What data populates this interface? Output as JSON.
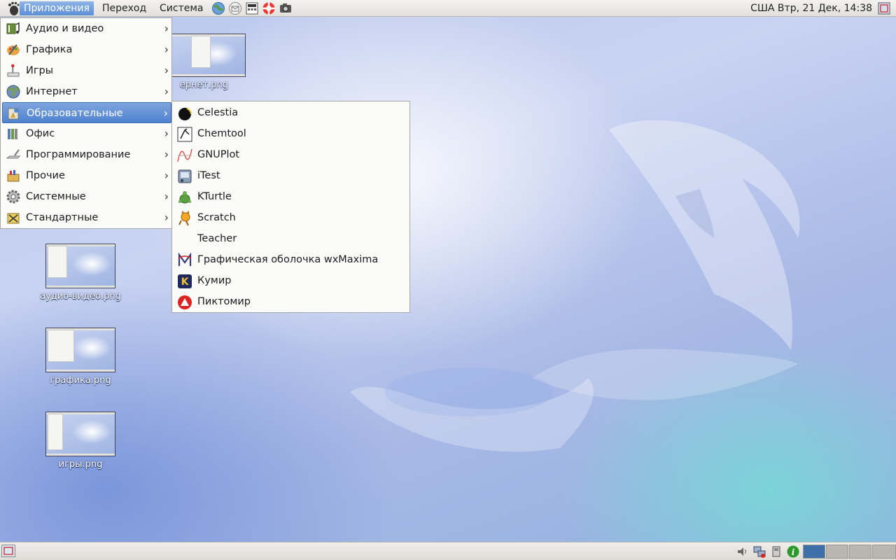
{
  "top_panel": {
    "menus": {
      "applications": "Приложения",
      "places": "Переход",
      "system": "Система"
    },
    "launchers": [
      "web-browser-icon",
      "mail-icon",
      "calculator-icon",
      "help-icon",
      "screenshot-icon"
    ],
    "clock": "США Втр, 21 Дек, 14:38"
  },
  "desktop_icons": [
    {
      "label": "Интернет.png",
      "visible_label": "ернет.png"
    },
    {
      "label": "аудио-видео.png"
    },
    {
      "label": "графика.png"
    },
    {
      "label": "игры.png"
    }
  ],
  "main_menu": {
    "items": [
      {
        "label": "Аудио и видео",
        "icon": "audio-video-icon"
      },
      {
        "label": "Графика",
        "icon": "graphics-icon"
      },
      {
        "label": "Игры",
        "icon": "games-icon"
      },
      {
        "label": "Интернет",
        "icon": "internet-icon"
      },
      {
        "label": "Образовательные",
        "icon": "education-icon",
        "active": true
      },
      {
        "label": "Офис",
        "icon": "office-icon"
      },
      {
        "label": "Программирование",
        "icon": "programming-icon"
      },
      {
        "label": "Прочие",
        "icon": "other-icon"
      },
      {
        "label": "Системные",
        "icon": "system-icon"
      },
      {
        "label": "Стандартные",
        "icon": "accessories-icon"
      }
    ],
    "arrow": "›"
  },
  "sub_menu": {
    "items": [
      {
        "label": "Celestia",
        "icon": "celestia-icon"
      },
      {
        "label": "Chemtool",
        "icon": "chemtool-icon"
      },
      {
        "label": "GNUPlot",
        "icon": "gnuplot-icon"
      },
      {
        "label": "iTest",
        "icon": "itest-icon"
      },
      {
        "label": "KTurtle",
        "icon": "kturtle-icon"
      },
      {
        "label": "Scratch",
        "icon": "scratch-icon"
      },
      {
        "label": "Teacher",
        "icon": "teacher-icon"
      },
      {
        "label": "Графическая оболочка wxMaxima",
        "icon": "wxmaxima-icon"
      },
      {
        "label": "Кумир",
        "icon": "kumir-icon"
      },
      {
        "label": "Пиктомир",
        "icon": "piktomir-icon"
      }
    ]
  },
  "colors": {
    "menu_highlight": "#5b8ed6",
    "panel_bg": "#e8e6e2",
    "workspace_active": "#3f6fa8"
  }
}
